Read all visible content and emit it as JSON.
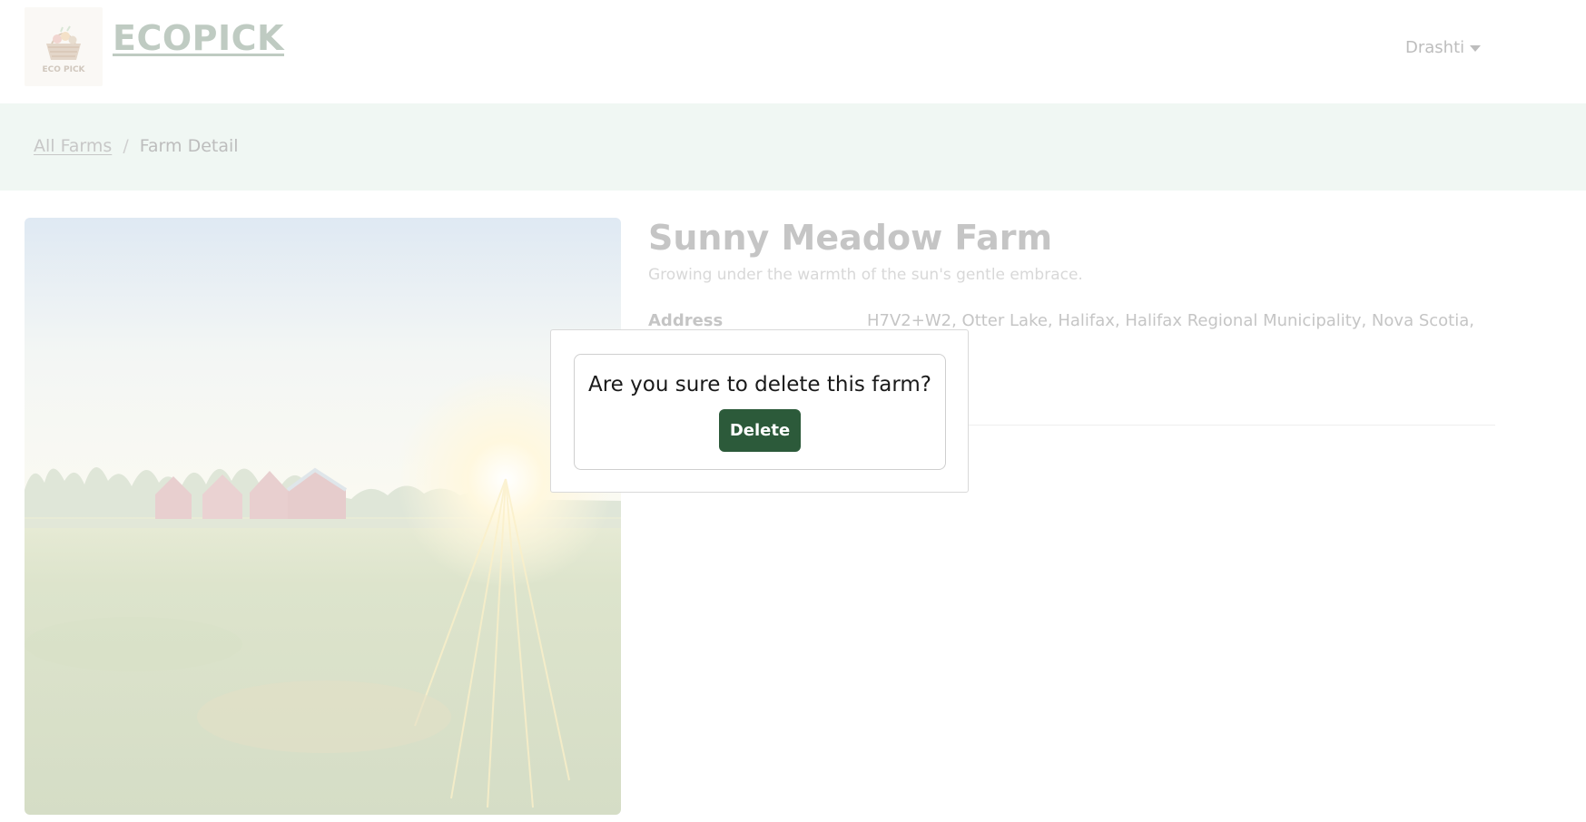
{
  "header": {
    "brand": "ECOPICK",
    "logo_text": "ECO PICK",
    "user_name": "Drashti",
    "user_caret_icon": "caret-down-icon"
  },
  "breadcrumb": {
    "link": "All Farms",
    "separator": "/",
    "current": "Farm Detail"
  },
  "farm": {
    "image_alt": "farm-landscape-photo",
    "title": "Sunny Meadow Farm",
    "subtitle": "Growing under the warmth of the sun's gentle embrace.",
    "address_label": "Address",
    "address_value": "H7V2+W2, Otter Lake, Halifax, Halifax Regional Municipality, Nova Scotia,"
  },
  "modal": {
    "question": "Are you sure to delete this farm?",
    "delete_label": "Delete"
  },
  "colors": {
    "delete_button": "#2c5a3a",
    "crumb_band": "#f0f7f3",
    "brand_text": "#bfcbc2"
  }
}
